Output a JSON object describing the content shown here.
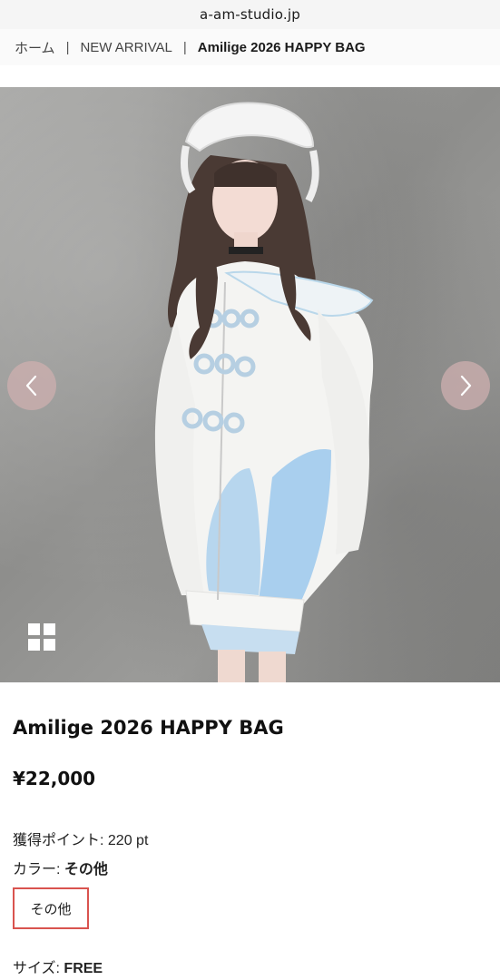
{
  "browser": {
    "url": "a-am-studio.jp"
  },
  "breadcrumb": {
    "items": [
      "ホーム",
      "NEW ARRIVAL",
      "Amilige 2026 HAPPY BAG"
    ],
    "separator": "|"
  },
  "gallery": {
    "prev_icon": "chevron-left-icon",
    "next_icon": "chevron-right-icon",
    "thumbnails_icon": "grid-icon"
  },
  "product": {
    "title": "Amilige 2026 HAPPY BAG",
    "price": "¥22,000",
    "points_label": "獲得ポイント:",
    "points_value": "220 pt",
    "color_label": "カラー:",
    "color_value": "その他",
    "color_options": [
      "その他"
    ],
    "size_label": "サイズ:",
    "size_value": "FREE"
  },
  "colors": {
    "selected_border": "#d9534f",
    "arrow_bg": "#cdafaf"
  }
}
